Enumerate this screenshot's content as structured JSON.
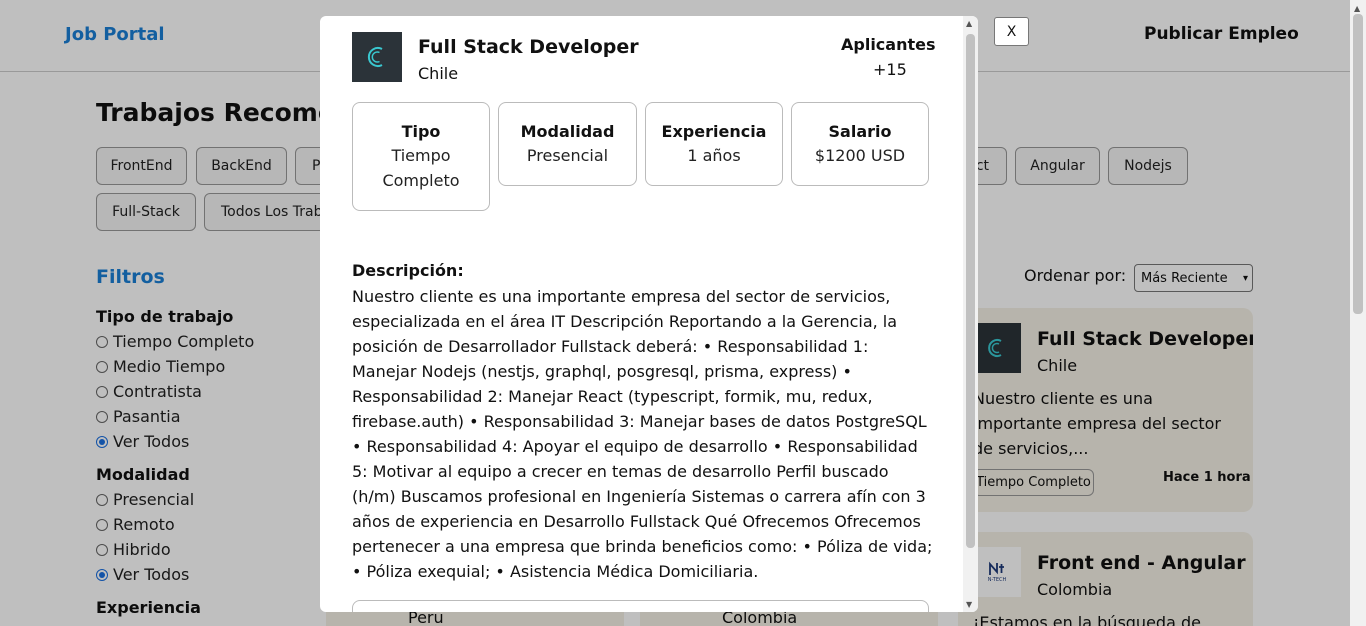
{
  "navbar": {
    "logo": "Job Portal",
    "publish": "Publicar Empleo"
  },
  "main": {
    "title": "Trabajos Recomendados",
    "category_chips": [
      {
        "label": "FrontEnd"
      },
      {
        "label": "BackEnd"
      },
      {
        "label": "P"
      },
      {
        "label": "ct"
      },
      {
        "label": "Angular"
      },
      {
        "label": "Nodejs"
      },
      {
        "label": "Full-Stack"
      },
      {
        "label": "Todos Los Trabajos"
      }
    ]
  },
  "filters": {
    "title": "Filtros",
    "job_type": {
      "label": "Tipo de trabajo",
      "options": [
        {
          "label": "Tiempo Completo"
        },
        {
          "label": "Medio Tiempo"
        },
        {
          "label": "Contratista"
        },
        {
          "label": "Pasantia"
        },
        {
          "label": "Ver Todos"
        }
      ],
      "selected": "Ver Todos"
    },
    "modality": {
      "label": "Modalidad",
      "options": [
        {
          "label": "Presencial"
        },
        {
          "label": "Remoto"
        },
        {
          "label": "Hibrido"
        },
        {
          "label": "Ver Todos"
        }
      ],
      "selected": "Ver Todos"
    },
    "experience": {
      "label": "Experiencia"
    }
  },
  "sort": {
    "label": "Ordenar por:",
    "selected": "Más Reciente"
  },
  "job_cards": [
    {
      "title": "Full Stack Developer",
      "country": "Chile",
      "description": "Nuestro cliente es una importante empresa del sector de servicios,...",
      "tag": "Tiempo Completo",
      "posted": "Hace 1 hora"
    },
    {
      "title": "Front end - Angular",
      "country": "Colombia",
      "description": "¡Estamos en la búsqueda de",
      "logo_text": "N-TECH"
    }
  ],
  "bottom_cards": [
    {
      "country": "Peru"
    },
    {
      "country": "Colombia"
    }
  ],
  "modal": {
    "close_label": "X",
    "title": "Full Stack Developer",
    "country": "Chile",
    "applicants_label": "Aplicantes",
    "applicants_count": "+15",
    "info": [
      {
        "label": "Tipo",
        "value": "Tiempo Completo"
      },
      {
        "label": "Modalidad",
        "value": "Presencial"
      },
      {
        "label": "Experiencia",
        "value": "1 años"
      },
      {
        "label": "Salario",
        "value": "$1200 USD"
      }
    ],
    "description_label": "Descripción:",
    "description": "Nuestro cliente es una importante empresa del sector de servicios, especializada en el área IT Descripción Reportando a la Gerencia, la posición de Desarrollador Fullstack deberá: • Responsabilidad 1: Manejar Nodejs (nestjs, graphql, posgresql, prisma, express) • Responsabilidad 2: Manejar React (typescript, formik, mu, redux, firebase.auth) • Responsabilidad 3: Manejar bases de datos PostgreSQL • Responsabilidad 4: Apoyar el equipo de desarrollo • Responsabilidad 5: Motivar al equipo a crecer en temas de desarrollo Perfil buscado (h/m) Buscamos profesional en Ingeniería Sistemas o carrera afín con 3 años de experiencia en Desarrollo Fullstack Qué Ofrecemos Ofrecemos pertenecer a una empresa que brinda beneficios como: • Póliza de vida; • Póliza exequial; • Asistencia Médica Domiciliaria."
  },
  "colors": {
    "brand": "#1a7fd6",
    "card_bg": "#f5f1e6",
    "logo_bg": "#2b3339",
    "radio_selected": "#1a6fe0",
    "overlay": "rgba(0,0,0,0.25)"
  },
  "icons": {
    "company_logo": "c-swirl-logo-icon",
    "select_caret": "chevron-down-icon",
    "scroll_up": "triangle-up-icon",
    "scroll_down": "triangle-down-icon"
  }
}
